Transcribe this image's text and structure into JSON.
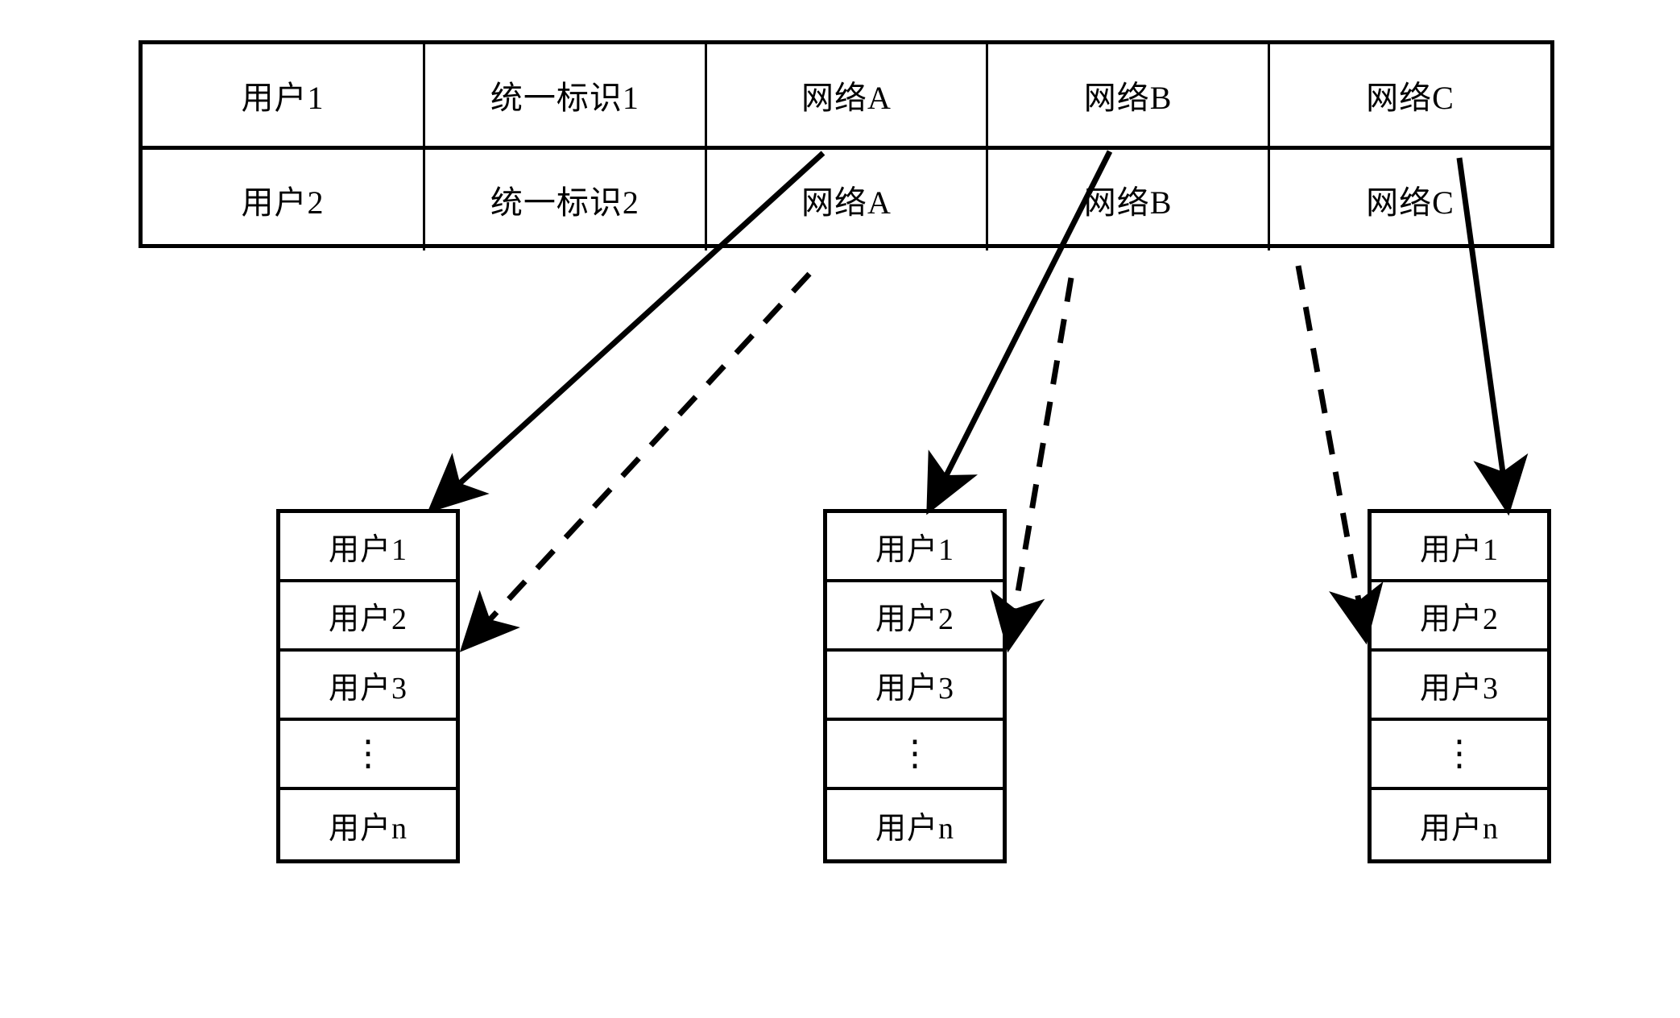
{
  "diagram": {
    "title_text": "",
    "mapping_table": {
      "columns": 5,
      "rows": [
        [
          "用户1",
          "统一标识1",
          "网络A",
          "网络B",
          "网络C"
        ],
        [
          "用户2",
          "统一标识2",
          "网络A",
          "网络B",
          "网络C"
        ]
      ],
      "empty_row_present": true
    },
    "user_lists": [
      {
        "id": "network-a-user-list",
        "entries": [
          "用户1",
          "用户2",
          "用户3",
          "⋮",
          "用户n"
        ]
      },
      {
        "id": "network-b-user-list",
        "entries": [
          "用户1",
          "用户2",
          "用户3",
          "⋮",
          "用户n"
        ]
      },
      {
        "id": "network-c-user-list",
        "entries": [
          "用户1",
          "用户2",
          "用户3",
          "⋮",
          "用户n"
        ]
      }
    ],
    "connectors": [
      {
        "from": "网络A",
        "row": 1,
        "to": "network-a-user-list",
        "target_entry": "用户1",
        "style": "solid"
      },
      {
        "from": "网络A",
        "row": 2,
        "to": "network-a-user-list",
        "target_entry": "用户2",
        "style": "dashed"
      },
      {
        "from": "网络B",
        "row": 1,
        "to": "network-b-user-list",
        "target_entry": "用户1",
        "style": "solid"
      },
      {
        "from": "网络B",
        "row": 2,
        "to": "network-b-user-list",
        "target_entry": "用户2",
        "style": "dashed"
      },
      {
        "from": "网络C",
        "row": 1,
        "to": "network-c-user-list",
        "target_entry": "用户1",
        "style": "solid"
      },
      {
        "from": "网络C",
        "row": 2,
        "to": "network-c-user-list",
        "target_entry": "用户2",
        "style": "dashed"
      }
    ],
    "colors": {
      "stroke": "#000000",
      "background": "#ffffff"
    }
  }
}
